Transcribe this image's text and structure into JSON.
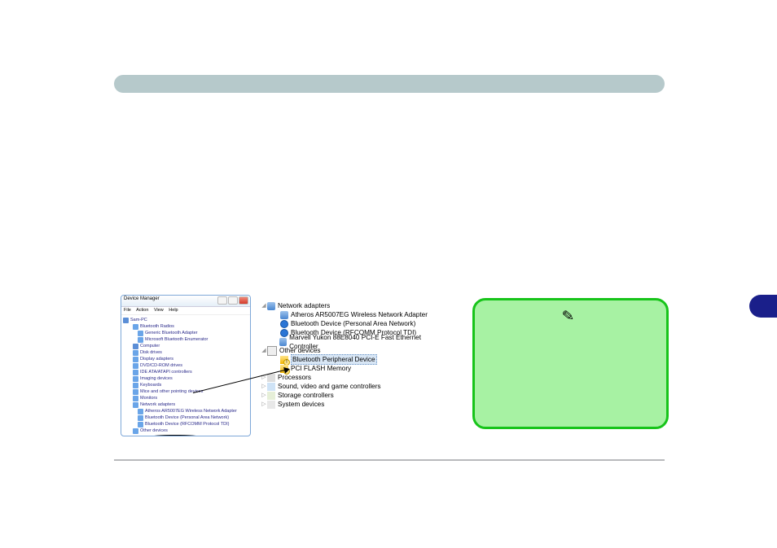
{
  "header": {
    "title": ""
  },
  "device_manager": {
    "window_title": "Device Manager",
    "menu": [
      "File",
      "Action",
      "View",
      "Help"
    ],
    "root": "Sam-PC",
    "tree": [
      {
        "label": "Bluetooth Radios",
        "indent": 1,
        "icon": "bt"
      },
      {
        "label": "Generic Bluetooth Adapter",
        "indent": 2,
        "icon": "bt"
      },
      {
        "label": "Microsoft Bluetooth Enumerator",
        "indent": 2,
        "icon": "bt"
      },
      {
        "label": "Computer",
        "indent": 1,
        "icon": "pc"
      },
      {
        "label": "Disk drives",
        "indent": 1,
        "icon": "dev"
      },
      {
        "label": "Display adapters",
        "indent": 1,
        "icon": "dev"
      },
      {
        "label": "DVD/CD-ROM drives",
        "indent": 1,
        "icon": "dev"
      },
      {
        "label": "IDE ATA/ATAPI controllers",
        "indent": 1,
        "icon": "dev"
      },
      {
        "label": "Imaging devices",
        "indent": 1,
        "icon": "dev"
      },
      {
        "label": "Keyboards",
        "indent": 1,
        "icon": "dev"
      },
      {
        "label": "Mice and other pointing devices",
        "indent": 1,
        "icon": "dev"
      },
      {
        "label": "Monitors",
        "indent": 1,
        "icon": "dev"
      },
      {
        "label": "Network adapters",
        "indent": 1,
        "icon": "net"
      },
      {
        "label": "Atheros AR5007EG Wireless Network Adapter",
        "indent": 2,
        "icon": "net"
      },
      {
        "label": "Bluetooth Device (Personal Area Network)",
        "indent": 2,
        "icon": "bt"
      },
      {
        "label": "Bluetooth Device (RFCOMM Protocol TDI)",
        "indent": 2,
        "icon": "bt"
      },
      {
        "label": "Other devices",
        "indent": 1,
        "icon": "oth"
      },
      {
        "label": "Bluetooth Peripheral Device",
        "indent": 2,
        "icon": "warn",
        "circled": true
      },
      {
        "label": "Processors",
        "indent": 1,
        "icon": "proc"
      },
      {
        "label": "Sound, video and game controllers",
        "indent": 1,
        "icon": "snd"
      },
      {
        "label": "Storage controllers",
        "indent": 1,
        "icon": "stor"
      },
      {
        "label": "System devices",
        "indent": 1,
        "icon": "sys"
      }
    ]
  },
  "zoom": {
    "rows": [
      {
        "expander": "◢",
        "icon": "net",
        "label": "Network adapters",
        "indent": 0
      },
      {
        "icon": "net",
        "label": "Atheros AR5007EG Wireless Network Adapter",
        "indent": 1
      },
      {
        "icon": "bt",
        "label": "Bluetooth Device (Personal Area Network)",
        "indent": 1
      },
      {
        "icon": "bt",
        "label": "Bluetooth Device (RFCOMM Protocol TDI)",
        "indent": 1
      },
      {
        "icon": "net",
        "label": "Marvell Yukon 88E8040 PCI-E Fast Ethernet Controller",
        "indent": 1
      },
      {
        "expander": "◢",
        "icon": "oth",
        "label": "Other devices",
        "indent": 0
      },
      {
        "icon": "warn",
        "label": "Bluetooth Peripheral Device",
        "indent": 1,
        "selected": true
      },
      {
        "icon": "warn",
        "label": "PCI FLASH Memory",
        "indent": 1
      },
      {
        "expander": "▷",
        "icon": "proc",
        "label": "Processors",
        "indent": 0
      },
      {
        "expander": "▷",
        "icon": "snd",
        "label": "Sound, video and game controllers",
        "indent": 0
      },
      {
        "expander": "▷",
        "icon": "stor",
        "label": "Storage controllers",
        "indent": 0
      },
      {
        "expander": "▷",
        "icon": "sys",
        "label": "System devices",
        "indent": 0
      }
    ]
  },
  "note": {
    "icon": "pencil-icon"
  },
  "colors": {
    "note_bg": "#a7f2a3",
    "note_border": "#17c41a",
    "header_bar": "#b6c9cb",
    "side_tab": "#1a1f8a"
  }
}
